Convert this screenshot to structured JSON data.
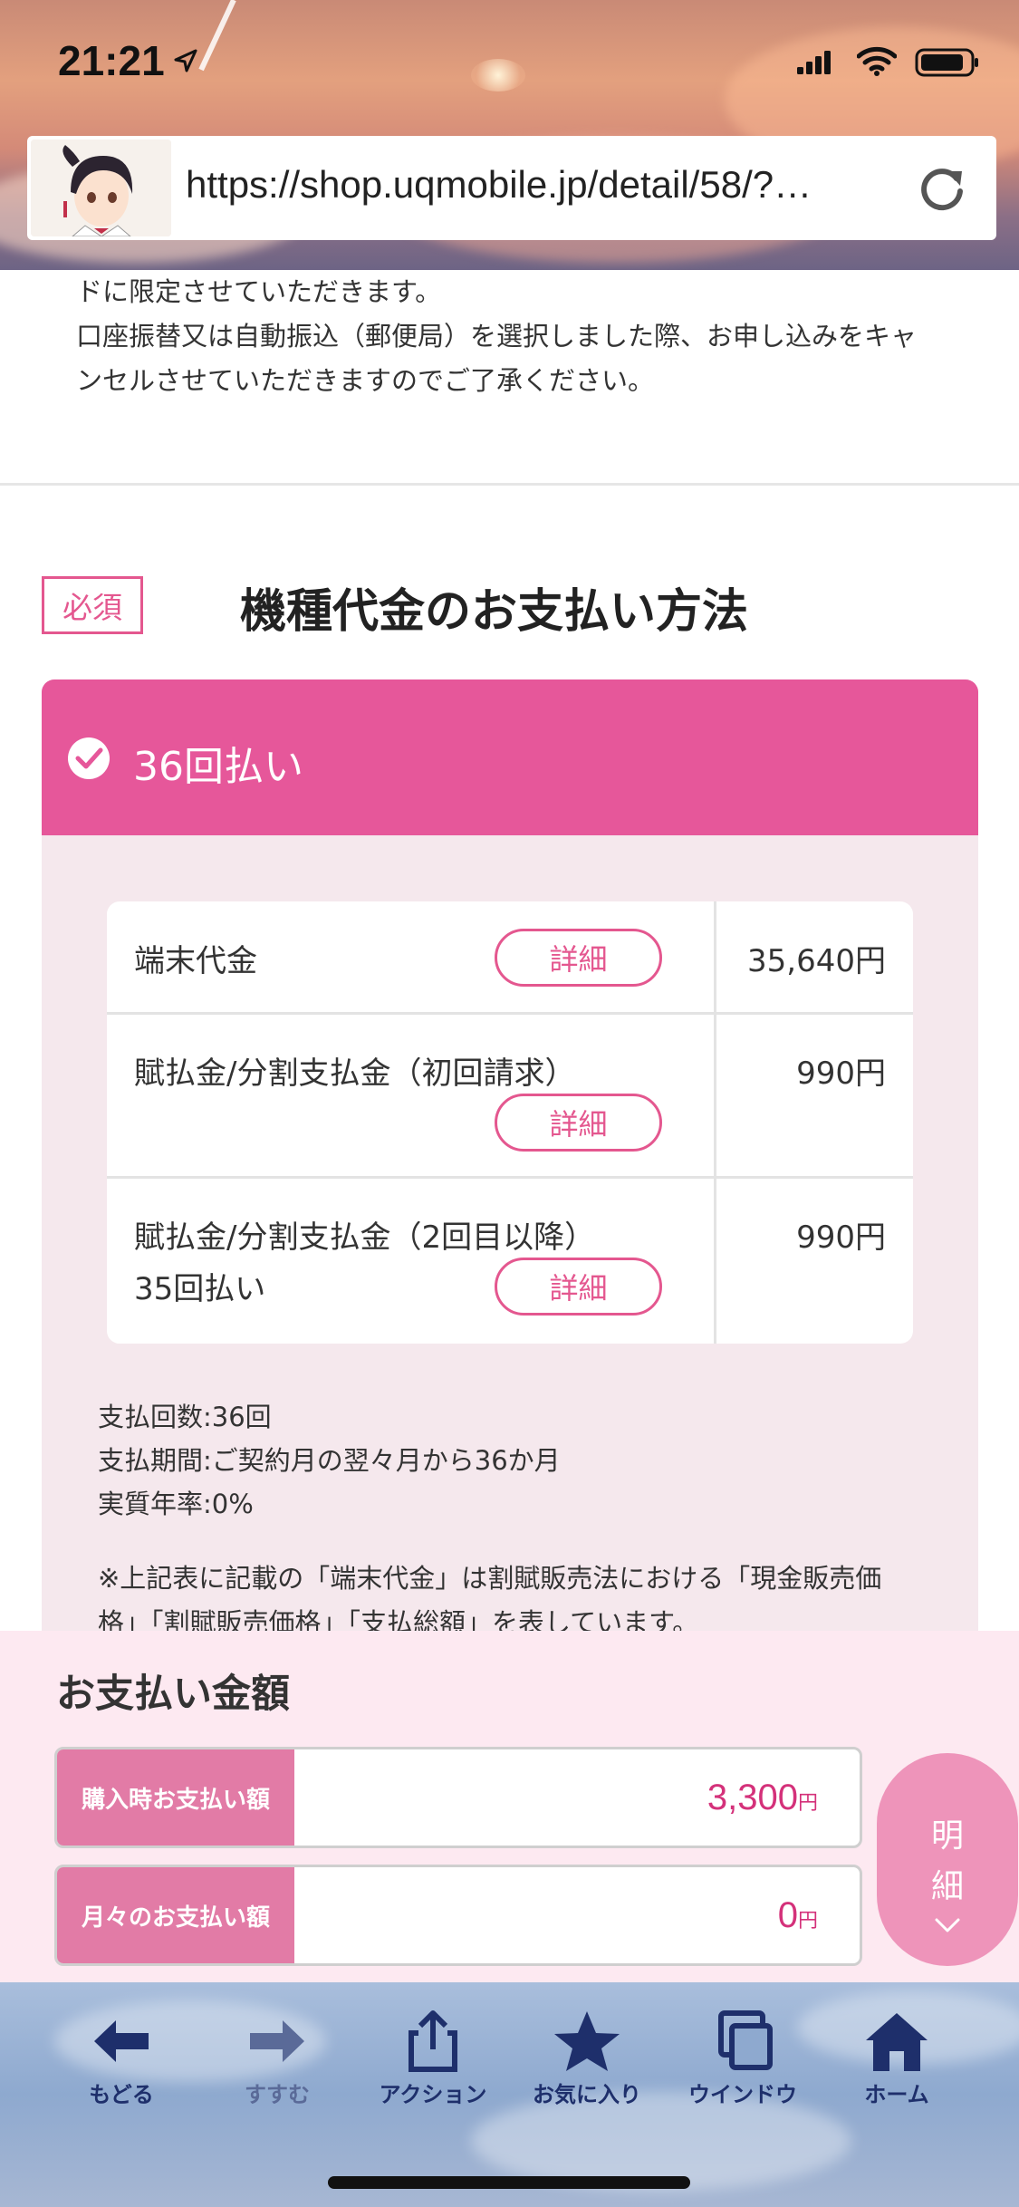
{
  "status_bar": {
    "time": "21:21"
  },
  "browser": {
    "url": "https://shop.uqmobile.jp/detail/58/?…"
  },
  "page": {
    "prev_notice_lines": [
      "ドに限定させていただきます。",
      "口座振替又は自動振込（郵便局）を選択しました際、お申し込みをキャ",
      "ンセルさせていただきますのでご了承ください。"
    ],
    "required_badge": "必須",
    "section_title": "機種代金のお支払い方法",
    "plan": {
      "label": "36回払い",
      "rows": [
        {
          "label": "端末代金",
          "label2": "",
          "amount": "35,640円",
          "detail": "詳細"
        },
        {
          "label": "賦払金/分割支払金（初回請求）",
          "label2": "",
          "amount": "990円",
          "detail": "詳細"
        },
        {
          "label": "賦払金/分割支払金（2回目以降）",
          "label2": "35回払い",
          "amount": "990円",
          "detail": "詳細"
        }
      ],
      "info": [
        "支払回数:36回",
        "支払期間:ご契約月の翌々月から36か月",
        "実質年率:0%"
      ],
      "note_lines": [
        "※上記表に記載の「端末代金」は割賦販売法における「現金販売価",
        "格」「割賦販売価格」「支払総額」を表しています。"
      ]
    }
  },
  "summary": {
    "title": "お支払い金額",
    "purchase_label": "購入時お支払い額",
    "purchase_value": "3,300",
    "monthly_label": "月々のお支払い額",
    "monthly_value": "0",
    "unit": "円",
    "breakdown_chars": [
      "明",
      "細"
    ]
  },
  "toolbar": {
    "back": "もどる",
    "forward": "すすむ",
    "action": "アクション",
    "favorites": "お気に入り",
    "window": "ウインドウ",
    "home": "ホーム"
  },
  "colors": {
    "accent_pink": "#e6579a",
    "card_bg": "#f5e8ed",
    "navy": "#1e2f6b"
  }
}
